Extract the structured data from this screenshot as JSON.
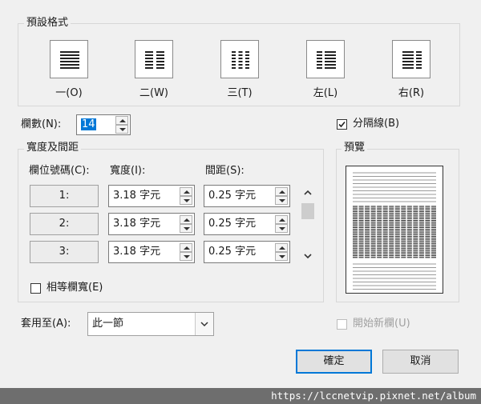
{
  "presets": {
    "title": "預設格式",
    "items": [
      {
        "label": "一(O)",
        "icon": "one-column-icon"
      },
      {
        "label": "二(W)",
        "icon": "two-columns-icon"
      },
      {
        "label": "三(T)",
        "icon": "three-columns-icon"
      },
      {
        "label": "左(L)",
        "icon": "left-column-icon"
      },
      {
        "label": "右(R)",
        "icon": "right-column-icon"
      }
    ]
  },
  "num_columns": {
    "label": "欄數(N):",
    "value": "14"
  },
  "line_between": {
    "label": "分隔線(B)",
    "checked": true
  },
  "width_spacing": {
    "title": "寬度及間距",
    "col_header": "欄位號碼(C):",
    "width_header": "寬度(I):",
    "spacing_header": "間距(S):",
    "rows": [
      {
        "num": "1:",
        "width": "3.18 字元",
        "spacing": "0.25 字元"
      },
      {
        "num": "2:",
        "width": "3.18 字元",
        "spacing": "0.25 字元"
      },
      {
        "num": "3:",
        "width": "3.18 字元",
        "spacing": "0.25 字元"
      }
    ],
    "equal_width": {
      "label": "相等欄寬(E)",
      "checked": false
    }
  },
  "preview": {
    "title": "預覽"
  },
  "apply_to": {
    "label": "套用至(A):",
    "value": "此一節"
  },
  "start_new_column": {
    "label": "開始新欄(U)",
    "checked": false,
    "enabled": false
  },
  "buttons": {
    "ok": "確定",
    "cancel": "取消"
  },
  "watermark": "https://lccnetvip.pixnet.net/album",
  "colors": {
    "accent": "#0078d7",
    "dialog_bg": "#f0f0f0",
    "footer_bg": "#6e6e6e"
  }
}
